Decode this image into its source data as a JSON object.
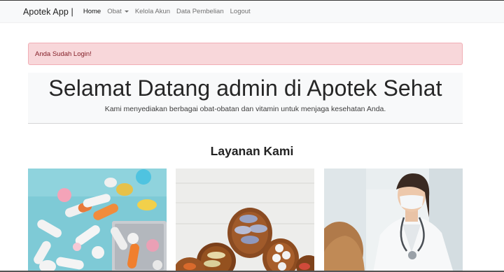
{
  "navbar": {
    "brand": "Apotek App |",
    "items": [
      {
        "label": "Home",
        "active": true,
        "dropdown": false
      },
      {
        "label": "Obat",
        "active": false,
        "dropdown": true
      },
      {
        "label": "Kelola Akun",
        "active": false,
        "dropdown": false
      },
      {
        "label": "Data Pembelian",
        "active": false,
        "dropdown": false
      },
      {
        "label": "Logout",
        "active": false,
        "dropdown": false
      }
    ]
  },
  "alert": {
    "text": "Anda Sudah Login!"
  },
  "hero": {
    "title": "Selamat Datang admin di Apotek Sehat",
    "subtitle": "Kami menyediakan berbagai obat-obatan dan vitamin untuk menjaga kesehatan Anda."
  },
  "services": {
    "title": "Layanan Kami",
    "images": [
      "pills-capsules-image",
      "medicine-spoons-image",
      "doctor-consultation-image"
    ]
  },
  "colors": {
    "alert_bg": "#f8d7da",
    "alert_text": "#842029",
    "navbar_bg": "#f8f9fa",
    "hero_bg": "#f8f9fa"
  }
}
